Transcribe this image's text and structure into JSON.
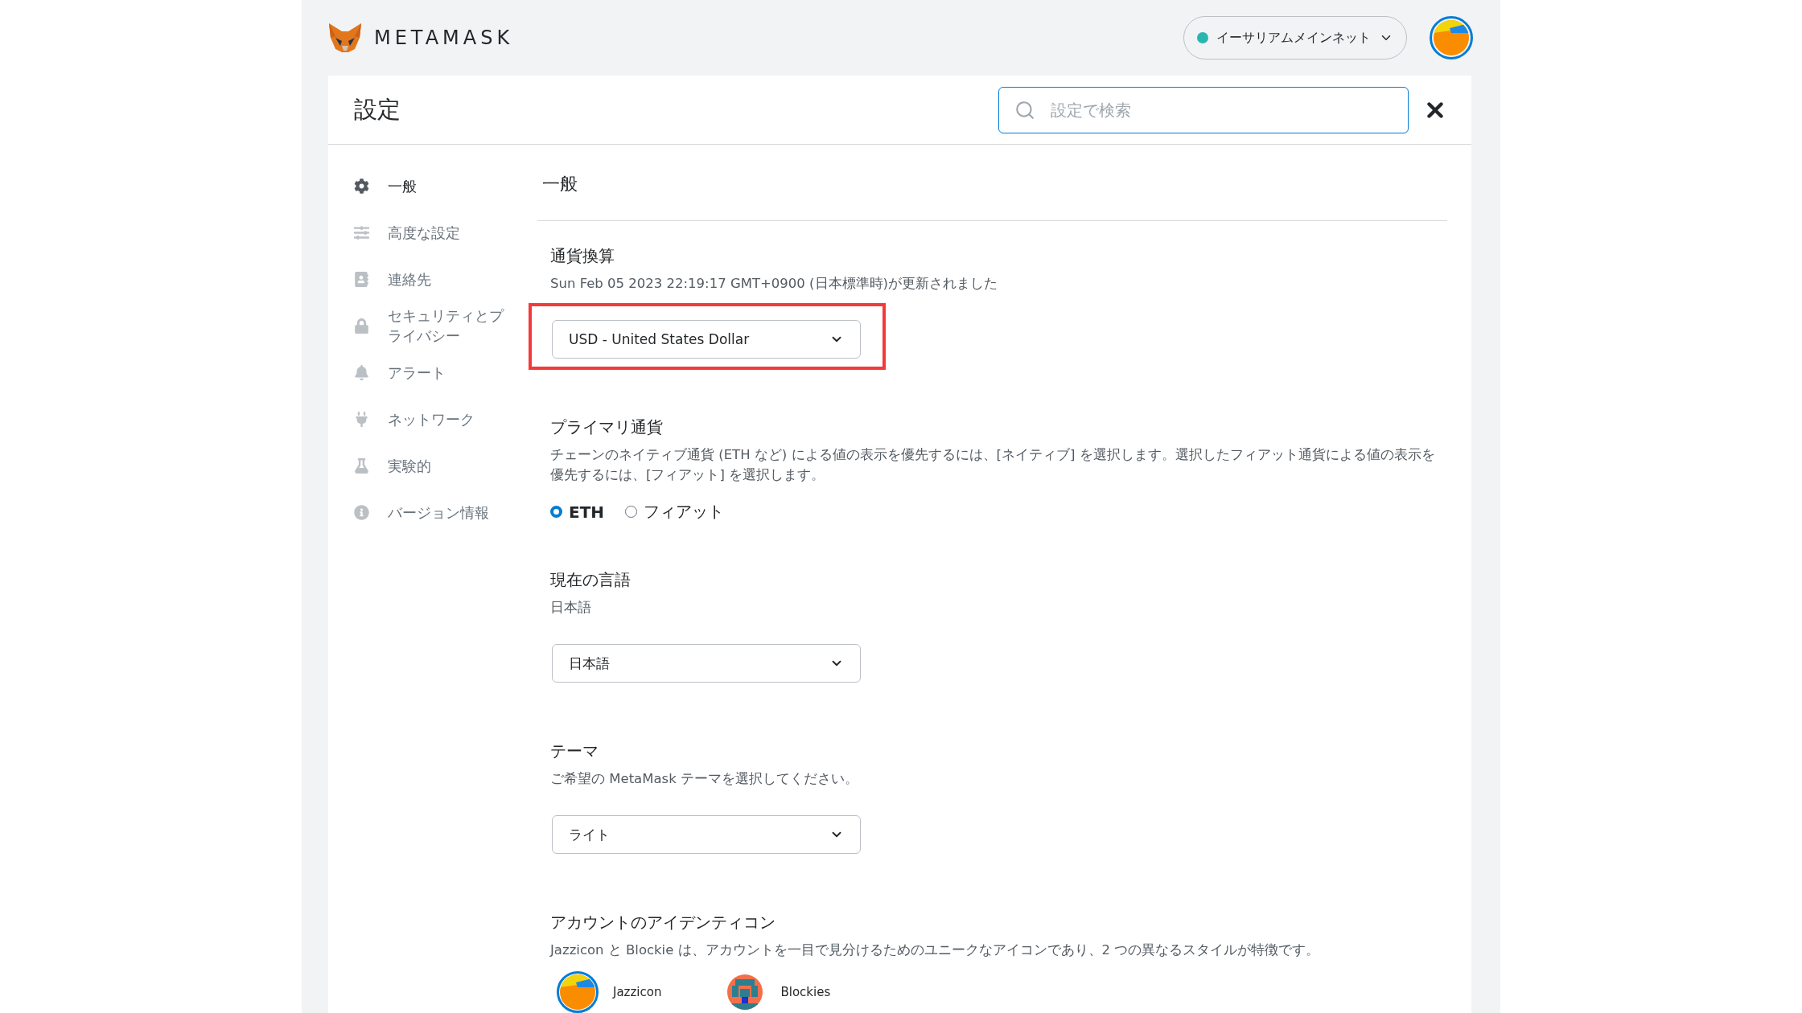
{
  "header": {
    "logo_text": "METAMASK",
    "network": "イーサリアムメインネット"
  },
  "settings": {
    "title": "設定",
    "search_placeholder": "設定で検索"
  },
  "sidebar": {
    "items": [
      {
        "label": "一般",
        "selected": true
      },
      {
        "label": "高度な設定",
        "selected": false
      },
      {
        "label": "連絡先",
        "selected": false
      },
      {
        "label": "セキュリティとプライバシー",
        "selected": false
      },
      {
        "label": "アラート",
        "selected": false
      },
      {
        "label": "ネットワーク",
        "selected": false
      },
      {
        "label": "実験的",
        "selected": false
      },
      {
        "label": "バージョン情報",
        "selected": false
      }
    ]
  },
  "content": {
    "title": "一般",
    "sections": [
      {
        "kind": "dropdown",
        "title": "通貨換算",
        "description": "Sun Feb 05 2023 22:19:17 GMT+0900 (日本標準時)が更新されました",
        "value": "USD - United States Dollar",
        "highlighted": true
      },
      {
        "kind": "radio",
        "title": "プライマリ通貨",
        "description": "チェーンのネイティブ通貨 (ETH など) による値の表示を優先するには、[ネイティブ] を選択します。選択したフィアット通貨による値の表示を優先するには、[フィアット] を選択します。",
        "options": [
          {
            "label": "ETH",
            "selected": true
          },
          {
            "label": "フィアット",
            "selected": false
          }
        ]
      },
      {
        "kind": "dropdown",
        "title": "現在の言語",
        "description": "日本語",
        "value": "日本語",
        "highlighted": false
      },
      {
        "kind": "dropdown",
        "title": "テーマ",
        "description": "ご希望の MetaMask テーマを選択してください。",
        "value": "ライト",
        "highlighted": false
      },
      {
        "kind": "identicon",
        "title": "アカウントのアイデンティコン",
        "description": "Jazzicon と Blockie は、アカウントを一目で見分けるためのユニークなアイコンであり、2 つの異なるスタイルが特徴です。",
        "options": [
          {
            "label": "Jazzicon",
            "selected": true
          },
          {
            "label": "Blockies",
            "selected": false
          }
        ]
      }
    ]
  }
}
